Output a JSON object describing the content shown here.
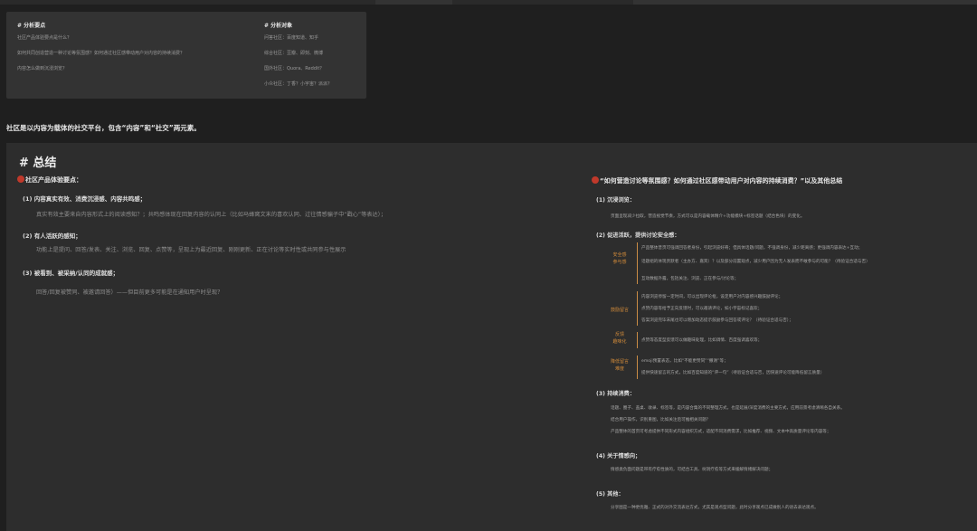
{
  "card": {
    "left_heading": "# 分析要点",
    "left_items": [
      "社区产品体验要点是什么？",
      "如何共同创造营造一种讨论等氛围感？如何通过社区感带动用户对内容的持续消费？",
      "内容怎么做到沉浸浏览？"
    ],
    "right_heading": "# 分析对象",
    "right_items": [
      "问答社区：百度知道、知乎",
      "综合社区：豆瓣、即刻、微博",
      "国外社区：Quora、Reddit？",
      "小众社区：丁香？小宇宙？派派？"
    ]
  },
  "intro": "社区是以内容为载体的社交平台，包含“内容”和“社交”两元素。",
  "summary": {
    "title": "# 总结",
    "left": {
      "heading": "社区产品体验要点：",
      "items": [
        {
          "h": "(1)  内容真实有效、消费沉浸感、内容共鸣感；",
          "t": "真实有效主要来自内容形式上的阅读感知？；共鸣感体现在回复内容的认同上（比如马蜂窝文末的喜欢认同、过往情感骗子中“戳心”等表达）；"
        },
        {
          "h": "(2)  有人活跃的感知；",
          "t": "功能上是提问、回答/发表、关注、浏览、回复、点赞等，呈现上为最近回复、刚刚更新、正在讨论等实时性或共同参与性展示"
        },
        {
          "h": "(3)  被看到、被采纳/认同的成就感；",
          "t": "回答/回复被赞同、被邀请回答）——但目前更多可能是在通知用户时呈现？"
        }
      ]
    },
    "right": {
      "heading": "“如何营造讨论等氛围感？如何通过社区感带动用户对内容的持续消费？”以及其他总结",
      "s1": {
        "h": "(1)  沉浸浏览：",
        "t": "页面呈现减少拉取，营造视觉节奏，方式可以是内容载体精介+功能模块+标签话题（结合色块）的变化。"
      },
      "s2": {
        "h": "(2)  促进活跃，提供讨论安全感：",
        "groups": [
          {
            "label": [
              "安全感",
              "参与感"
            ],
            "items": [
              "产品整体普页可强调回答者身份，引起浏览好奇；但具体话题/问题，不强调身份，减少距离感；更强调内容表达+互动；",
              "话题组的体现贵默者（主办方、嘉宾）？以及部分前置观点，减少用户因为无人发表而不敢参与的可能？（待验证合适与否）",
              "互动数据外露，包括关注、浏览、正在参与/讨论等；"
            ]
          },
          {
            "label": [
              "鼓励留言"
            ],
            "items": [
              "内容浏览停留一定时间，可以出现评论框，设定用户对内容感兴趣鼓励评论；",
              "点赞内容等给予正向反馈时，可以邀请评论，如小宇宙标记喜欢；",
              "答案浏览完毕末尾也可以增加动态提示鼓励参与回答或评论？（待验证合适与否）；"
            ]
          },
          {
            "label": [
              "反馈",
              "趣味化"
            ],
            "items": [
              "点赞等态度型反馈可以做趣味处理，比如调情、百度强调喜欢等；"
            ]
          },
          {
            "label": [
              "降低留言",
              "难度"
            ],
            "items": [
              "emoji预置表态，比如“不能更赞同”“撒谢”等；",
              "提供快速留言的方式，比如百度知道的“评一句”（待验证合适与否，因快速评论可能降低留言质量）"
            ]
          }
        ]
      },
      "s3": {
        "h": "(3)  持续消费：",
        "t": [
          "话题、圈子、盖桌、收录、标签等，是内容合集的不同整理方式，也是延展/深度消费的主要方式，应用前景考虑清晰各自关系。",
          "结合用户操作，识别重图，比如关注后可推相关问题？",
          "产品整体的首页可考虑提供不同形式内容组织方式，适配不同消费需求，比如推荐、视频、文本中高质量评论等内容等；"
        ]
      },
      "s4": {
        "h": "(4)  关于情感向；",
        "t": "情感类负面问题是带有疗愈性质的，可结合工具、树洞疗愈等方式来缓解情绪解决问题；"
      },
      "s5": {
        "h": "(5)  其他：",
        "t": "分享图是一种更优雅、正式的对外交流表达方式，尤其是观点型问题，此时分享观点已成做别人的语去表达观点。"
      }
    }
  }
}
